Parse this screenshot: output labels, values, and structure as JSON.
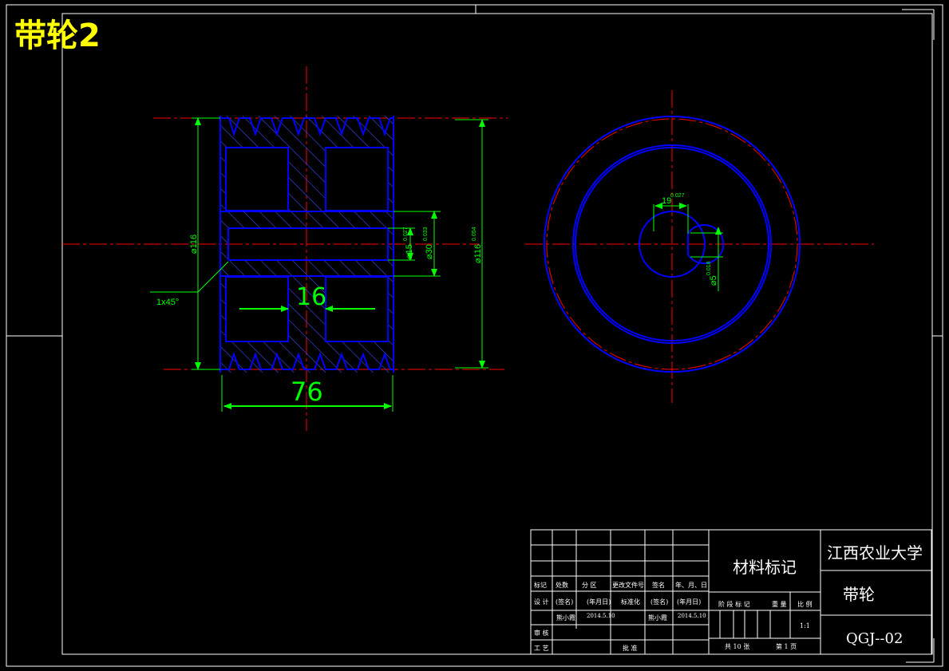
{
  "sheet": {
    "title": "带轮2",
    "colors": {
      "background": "#000000",
      "outline": "#0000ff",
      "centerline": "#ff0000",
      "dimension": "#00ff00",
      "border": "#ffffff",
      "title_label": "#ffff00",
      "hatch": "#3a4cff"
    }
  },
  "front_view": {
    "dim_dia_outer_left": "⌀116",
    "dim_bore": "⌀15",
    "dim_bore_tol": "0.027",
    "dim_hub": "⌀30",
    "dim_hub_tol": "0.033",
    "dim_dia_outer_right": "⌀116",
    "dim_dia_outer_right_tol": "0.054",
    "dim_web": "16",
    "dim_width": "76",
    "chamfer": "1x45°"
  },
  "side_view": {
    "dim_key_width": "19",
    "dim_key_width_tol": "0.027",
    "dim_shaft": "⌀5",
    "dim_shaft_tol": "0.018"
  },
  "title_block": {
    "material_label": "材料标记",
    "university": "江西农业大学",
    "part_name": "带轮",
    "drawing_no": "QGJ--02",
    "header_row": [
      "标记",
      "处数",
      "分 区",
      "更改文件号",
      "签名",
      "年、月、日"
    ],
    "design_label": "设 计",
    "sign_label_1": "(签名)",
    "date_label_1": "(年月日)",
    "std_label": "标准化",
    "sign_label_2": "(签名)",
    "date_label_2": "(年月日)",
    "designer": "熊小霞",
    "design_date": "2014.5.10",
    "std_person": "熊小霞",
    "std_date": "2014.5.10",
    "review_label": "审 核",
    "process_label": "工 艺",
    "approve_label": "批 准",
    "stage_label": "阶 段 标 记",
    "weight_label": "重 量",
    "scale_label": "比 例",
    "scale_value": "1:1",
    "sheets_total": "共 10 张",
    "sheet_no": "第 1 页"
  }
}
